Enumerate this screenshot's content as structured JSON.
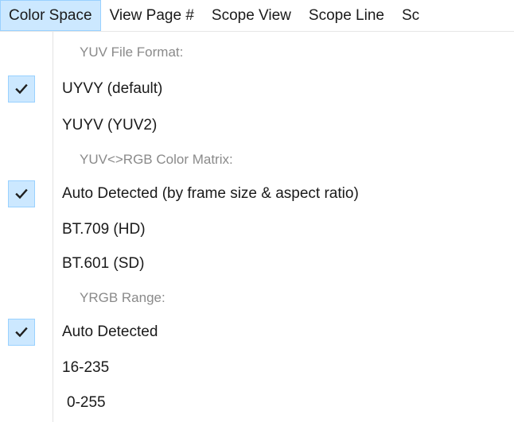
{
  "menubar": {
    "items": [
      "Color Space",
      "View Page #",
      "Scope View",
      "Scope Line",
      "Sc"
    ]
  },
  "dropdown": {
    "yuv_format": {
      "header": "YUV File Format:",
      "options": [
        {
          "label": "UYVY (default)",
          "checked": true
        },
        {
          "label": "YUYV (YUV2)",
          "checked": false
        }
      ]
    },
    "color_matrix": {
      "header": "YUV<>RGB Color Matrix:",
      "options": [
        {
          "label": "Auto Detected (by frame size & aspect ratio)",
          "checked": true
        },
        {
          "label": "BT.709 (HD)",
          "checked": false
        },
        {
          "label": "BT.601 (SD)",
          "checked": false
        }
      ]
    },
    "yrgb_range": {
      "header": "YRGB Range:",
      "options": [
        {
          "label": "Auto Detected",
          "checked": true
        },
        {
          "label": "16-235",
          "checked": false
        },
        {
          "label": "0-255",
          "checked": false
        }
      ]
    }
  },
  "icons": {
    "check": "checkmark-icon"
  },
  "colors": {
    "highlight_fill": "#cce8ff",
    "highlight_border": "#99d1ff",
    "header_text": "#8a8a8a",
    "check_color": "#1f1f1f"
  }
}
